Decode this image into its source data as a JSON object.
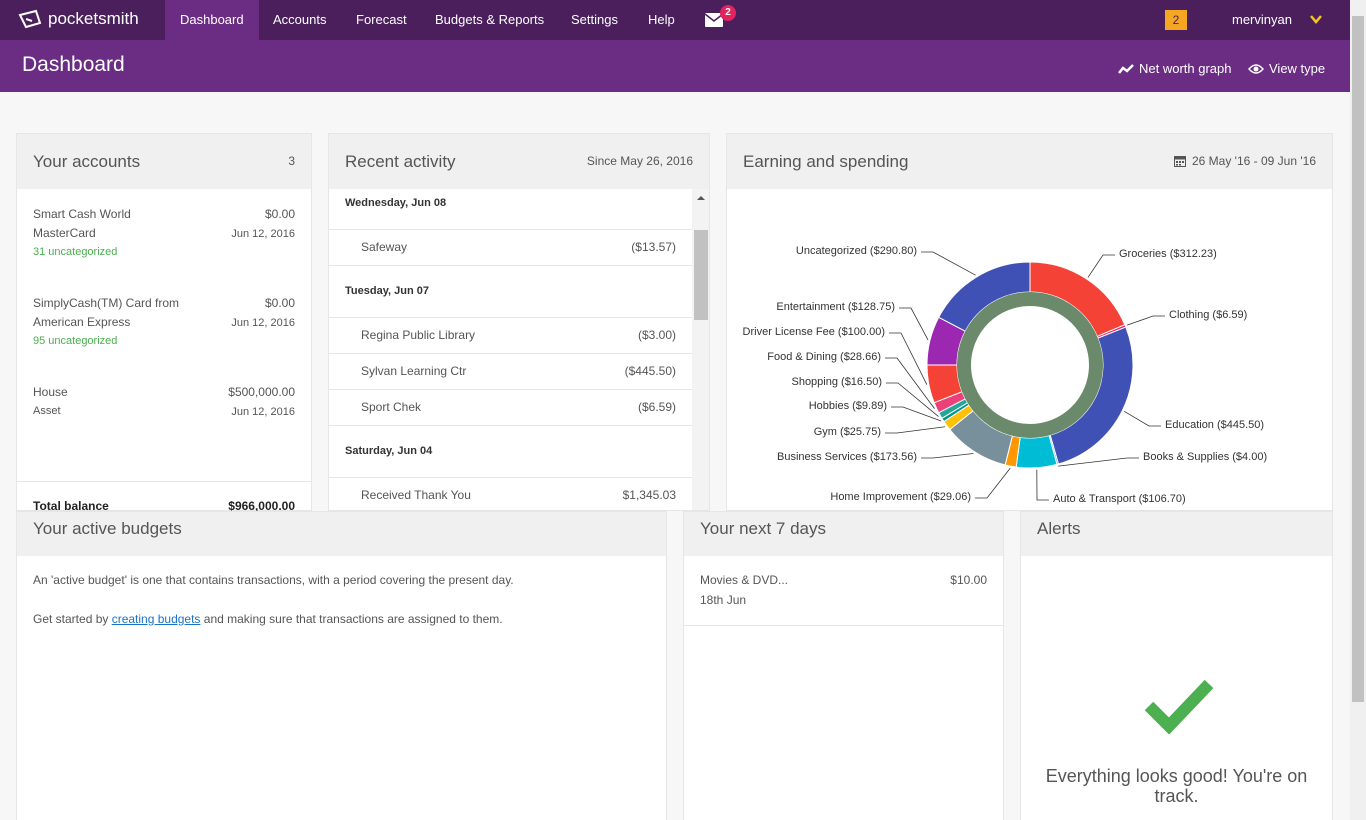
{
  "nav": {
    "brand": "pocketsmith",
    "items": [
      "Dashboard",
      "Accounts",
      "Forecast",
      "Budgets & Reports",
      "Settings",
      "Help"
    ],
    "mail_count": "2",
    "notif_count": "2",
    "user": "mervinyan"
  },
  "page": {
    "title": "Dashboard",
    "net_worth_link": "Net worth graph",
    "view_type_link": "View type"
  },
  "accounts_panel": {
    "title": "Your accounts",
    "count": "3",
    "accounts": [
      {
        "name_l1": "Smart Cash World",
        "name_l2": "MasterCard",
        "balance": "$0.00",
        "date": "Jun 12, 2016",
        "note": "31 uncategorized"
      },
      {
        "name_l1": "SimplyCash(TM) Card from",
        "name_l2": "American Express",
        "balance": "$0.00",
        "date": "Jun 12, 2016",
        "note": "95 uncategorized"
      },
      {
        "name_l1": "House",
        "name_l2": "Asset",
        "balance": "$500,000.00",
        "date": "Jun 12, 2016",
        "note": ""
      }
    ],
    "total_label": "Total balance",
    "total_value": "$966,000.00"
  },
  "activity_panel": {
    "title": "Recent activity",
    "since": "Since May 26, 2016",
    "days": [
      {
        "label": "Wednesday, Jun 08",
        "items": [
          {
            "name": "Safeway",
            "amount": "($13.57)"
          }
        ]
      },
      {
        "label": "Tuesday, Jun 07",
        "items": [
          {
            "name": "Regina Public Library",
            "amount": "($3.00)"
          },
          {
            "name": "Sylvan Learning Ctr",
            "amount": "($445.50)"
          },
          {
            "name": "Sport Chek",
            "amount": "($6.59)"
          }
        ]
      },
      {
        "label": "Saturday, Jun 04",
        "items": [
          {
            "name": "Received Thank You",
            "amount": "$1,345.03"
          }
        ]
      }
    ]
  },
  "earning_panel": {
    "title": "Earning and spending",
    "date_range": "26 May '16 - 09 Jun '16"
  },
  "chart_data": {
    "type": "pie",
    "style": "donut",
    "series": [
      {
        "label": "Groceries ($312.23)",
        "value": 312.23,
        "color": "#f44336"
      },
      {
        "label": "Clothing ($6.59)",
        "value": 6.59,
        "color": "#e91e63"
      },
      {
        "label": "Education ($445.50)",
        "value": 445.5,
        "color": "#3f51b5"
      },
      {
        "label": "Books & Supplies ($4.00)",
        "value": 4.0,
        "color": "#2196f3"
      },
      {
        "label": "Auto & Transport ($106.70)",
        "value": 106.7,
        "color": "#00bcd4"
      },
      {
        "label": "Home Improvement ($29.06)",
        "value": 29.06,
        "color": "#ff9800"
      },
      {
        "label": "Business Services ($173.56)",
        "value": 173.56,
        "color": "#78909c"
      },
      {
        "label": "Gym ($25.75)",
        "value": 25.75,
        "color": "#ffc107"
      },
      {
        "label": "Hobbies ($9.89)",
        "value": 9.89,
        "color": "#009688"
      },
      {
        "label": "Shopping ($16.50)",
        "value": 16.5,
        "color": "#26a69a"
      },
      {
        "label": "Food & Dining ($28.66)",
        "value": 28.66,
        "color": "#ec407a"
      },
      {
        "label": "Driver License Fee ($100.00)",
        "value": 100.0,
        "color": "#f44336"
      },
      {
        "label": "Entertainment ($128.75)",
        "value": 128.75,
        "color": "#9c27b0"
      },
      {
        "label": "Uncategorized ($290.80)",
        "value": 290.8,
        "color": "#3f51b5"
      }
    ],
    "inner_ring_color": "#6b8a6b"
  },
  "budgets_panel": {
    "title": "Your active budgets",
    "line1": "An 'active budget' is one that contains transactions, with a period covering the present day.",
    "line2_pre": "Get started by ",
    "line2_link": "creating budgets",
    "line2_post": " and making sure that transactions are assigned to them."
  },
  "next7_panel": {
    "title": "Your next 7 days",
    "item_name": "Movies & DVD...",
    "item_amount": "$10.00",
    "item_date": "18th Jun"
  },
  "alerts_panel": {
    "title": "Alerts",
    "message": "Everything looks good! You're on track.",
    "check_color": "#4caf50"
  }
}
